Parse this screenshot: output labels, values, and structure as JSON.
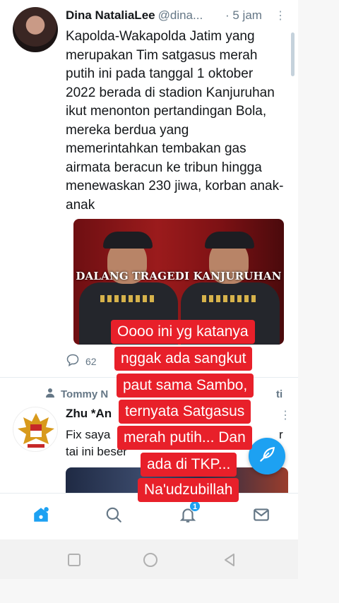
{
  "tweet1": {
    "name": "Dina NataliaLee",
    "handle": "@dina...",
    "time": "· 5 jam",
    "more": "⋮",
    "text": "Kapolda-Wakapolda Jatim yang merupakan Tim satgasus merah putih ini pada tanggal 1 oktober 2022 berada di stadion Kanjuruhan ikut menonton pertandingan Bola, mereka berdua yang memerintahkan tembakan gas airmata beracun ke tribun hingga menewaskan 230 jiwa, korban anak-anak",
    "media_caption": "DALANG TRAGEDI KANJURUHAN",
    "reply_count": "62"
  },
  "tweet2": {
    "retweeted_by": "Tommy N",
    "retweeted_suffix": "ti",
    "name": "Zhu *An",
    "text": "Fix saya",
    "text_tail": "r",
    "text_line2": "tai ini beser",
    "more": "⋮"
  },
  "caption_overlay": {
    "lines": [
      "Oooo ini yg katanya",
      "nggak ada sangkut",
      "paut sama Sambo,",
      "ternyata Satgasus",
      "merah putih... Dan",
      "ada di TKP...",
      "Na'udzubillah"
    ]
  },
  "tabbar": {
    "notification_badge": "1",
    "icons": [
      "home-icon",
      "search-icon",
      "notifications-icon",
      "messages-icon"
    ]
  },
  "colors": {
    "accent": "#1da1f2",
    "caption_bg": "#e8202a",
    "muted_text": "#657786"
  }
}
